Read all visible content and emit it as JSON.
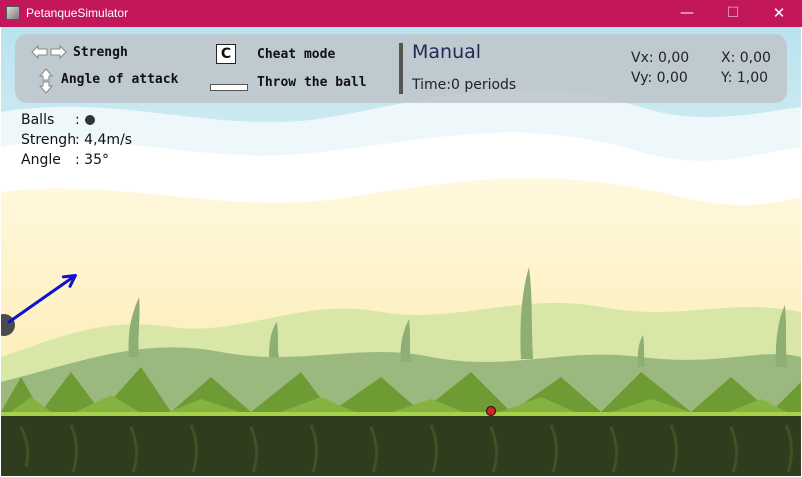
{
  "window": {
    "title": "PetanqueSimulator",
    "controls": {
      "minimize": "—",
      "maximize": "☐",
      "close": "✕"
    }
  },
  "hud": {
    "controls": {
      "strength_label": "Strengh",
      "angle_label": "Angle of attack",
      "cheat_key": "C",
      "cheat_label": "Cheat mode",
      "throw_label": "Throw the ball"
    },
    "mode": "Manual",
    "time": "Time:0 periods",
    "vx": "Vx: 0,00",
    "vy": "Vy: 0,00",
    "x": "X: 0,00",
    "y": "Y: 1,00"
  },
  "stats": {
    "balls_label": "Balls",
    "balls_sep": ":",
    "balls_remaining": 1,
    "strength_label": "Strengh",
    "strength_value": ": 4,4m/s",
    "angle_label": "Angle",
    "angle_value": ": 35°"
  },
  "scene": {
    "aim_angle_deg": 35,
    "colors": {
      "aim_arrow": "#1010d0",
      "target_ball": "#e02020",
      "player_ball": "#4a4a4a"
    }
  }
}
